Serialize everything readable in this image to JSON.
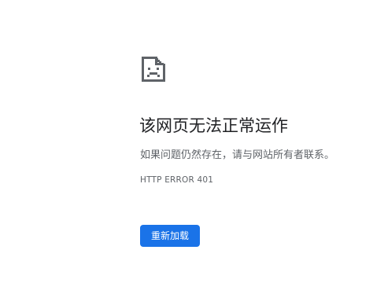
{
  "icon": "sad-document-icon",
  "heading": "该网页无法正常运作",
  "suggestion": "如果问题仍然存在，请与网站所有者联系。",
  "error_code": "HTTP ERROR 401",
  "reload_button_label": "重新加载",
  "colors": {
    "button": "#1a73e8",
    "heading": "#202124",
    "secondary_text": "#5f6368",
    "icon": "#5f6368"
  }
}
